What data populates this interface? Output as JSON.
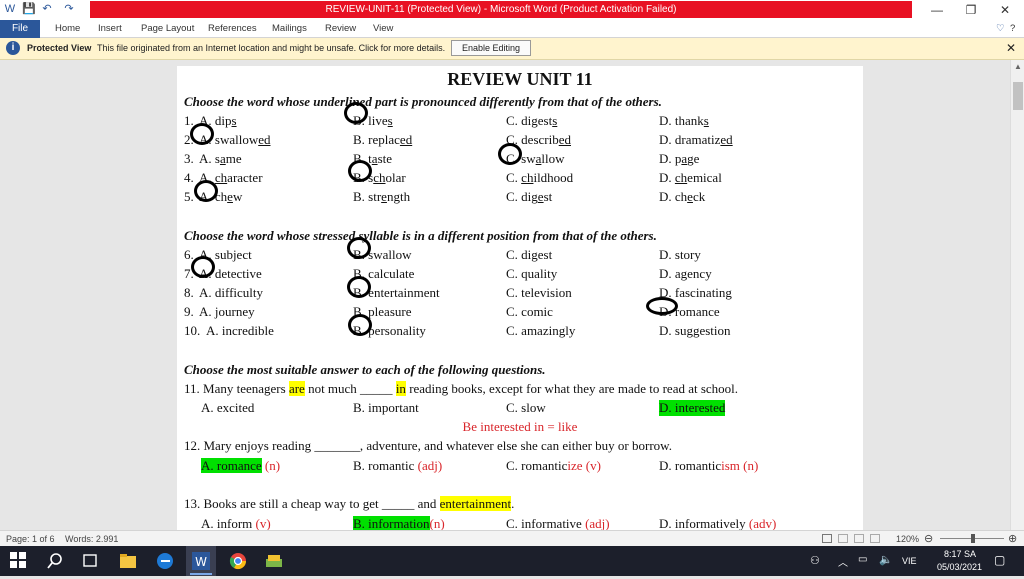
{
  "window": {
    "title": "REVIEW-UNIT-11 (Protected View)  -  Microsoft Word (Product Activation Failed)",
    "minimize": "—",
    "maximize": "❐",
    "close": "✕"
  },
  "ribbon": {
    "file": "File",
    "tabs": [
      "Home",
      "Insert",
      "Page Layout",
      "References",
      "Mailings",
      "Review",
      "View"
    ]
  },
  "protected_view": {
    "label": "Protected View",
    "message": "This file originated from an Internet location and might be unsafe. Click for more details.",
    "button": "Enable Editing",
    "close": "✕"
  },
  "document": {
    "title": "REVIEW UNIT 11",
    "section1": {
      "instruction": "Choose the word whose underlined part is pronounced differently from that of the others.",
      "questions": [
        {
          "num": "1.",
          "a": "A. dip",
          "a_u": "s",
          "b": "B. live",
          "b_u": "s",
          "c": "C. digest",
          "c_u": "s",
          "d": "D. thank",
          "d_u": "s"
        },
        {
          "num": "2.",
          "a": "A. swallow",
          "a_u": "ed",
          "b": "B. replac",
          "b_u": "ed",
          "c": "C. describ",
          "c_u": "ed",
          "d": "D. dramatiz",
          "d_u": "ed"
        },
        {
          "num": "3.",
          "a": "A. s",
          "a_u": "a",
          "a_post": "me",
          "b": "B. t",
          "b_u": "a",
          "b_post": "ste",
          "c": "C. sw",
          "c_u": "a",
          "c_post": "llow",
          "d": "D. p",
          "d_u": "a",
          "d_post": "ge"
        },
        {
          "num": "4.",
          "a": "A. ",
          "a_u": "ch",
          "a_post": "aracter",
          "b": "B. s",
          "b_u": "ch",
          "b_post": "olar",
          "c": "C. ",
          "c_u": "ch",
          "c_post": "ildhood",
          "d": "D. ",
          "d_u": "ch",
          "d_post": "emical"
        },
        {
          "num": "5.",
          "a": "A. ch",
          "a_u": "e",
          "a_post": "w",
          "b": "B. str",
          "b_u": "e",
          "b_post": "ngth",
          "c": "C. dig",
          "c_u": "e",
          "c_post": "st",
          "d": "D. ch",
          "d_u": "e",
          "d_post": "ck"
        }
      ]
    },
    "section2": {
      "instruction": "Choose the word whose stressed syllable is in a different position from that of the others.",
      "questions": [
        {
          "num": "6.",
          "a": "A. subject",
          "b": "B. swallow",
          "c": "C. digest",
          "d": "D. story"
        },
        {
          "num": "7.",
          "a": "A. detective",
          "b": "B. calculate",
          "c": "C. quality",
          "d": "D. agency"
        },
        {
          "num": "8.",
          "a": "A. difficulty",
          "b": "B. entertainment",
          "c": "C. television",
          "d": "D. fascinating"
        },
        {
          "num": "9.",
          "a": "A. journey",
          "b": "B. pleasure",
          "c": "C. comic",
          "d": "D. romance"
        },
        {
          "num": "10.",
          "a": "A. incredible",
          "b": "B. personality",
          "c": "C. amazingly",
          "d": "D. suggestion"
        }
      ]
    },
    "section3": {
      "instruction": "Choose the most suitable answer to each of the following questions.",
      "q11": {
        "pre": "11. Many teenagers ",
        "hl1": "are",
        "mid1": " not much _____ ",
        "hl2": "in",
        "post": " reading books, except for what they are made to read at school.",
        "a": "A. excited",
        "b": "B. important",
        "c": "C. slow",
        "d": "D. interested",
        "note": "Be interested  in  = like"
      },
      "q12": {
        "text": "12. Mary enjoys reading _______, adventure, and whatever else she can either buy or borrow.",
        "a": "A. romance",
        "a_tag": " (n)",
        "b": "B. romantic ",
        "b_tag": "(adj)",
        "c": "C. romantic",
        "c_red": "ize",
        "c_tag": " (v)",
        "d": "D. romantic",
        "d_red": "ism",
        "d_tag": "  (n)"
      },
      "q13": {
        "pre": "13. Books are still a cheap way to get _____ and ",
        "hl": "entertainment",
        "post": ".",
        "a": "A. inform ",
        "a_tag": "(v)",
        "b": "B. information",
        "b_tag": "(n)",
        "c": "C. informative ",
        "c_tag": "(adj)",
        "d": "D. informatively ",
        "d_tag": "(adv)"
      }
    }
  },
  "statusbar": {
    "page": "Page: 1 of 6",
    "words": "Words: 2.991",
    "zoom": "120%"
  },
  "taskbar": {
    "lang": "VIE",
    "time": "8:17 SA",
    "date": "05/03/2021"
  },
  "colors": {
    "word_blue": "#2b579a",
    "alert_red": "#e81123",
    "highlight_yellow": "#ffff00",
    "highlight_green": "#00e000",
    "annotation_red": "#d9252a"
  }
}
